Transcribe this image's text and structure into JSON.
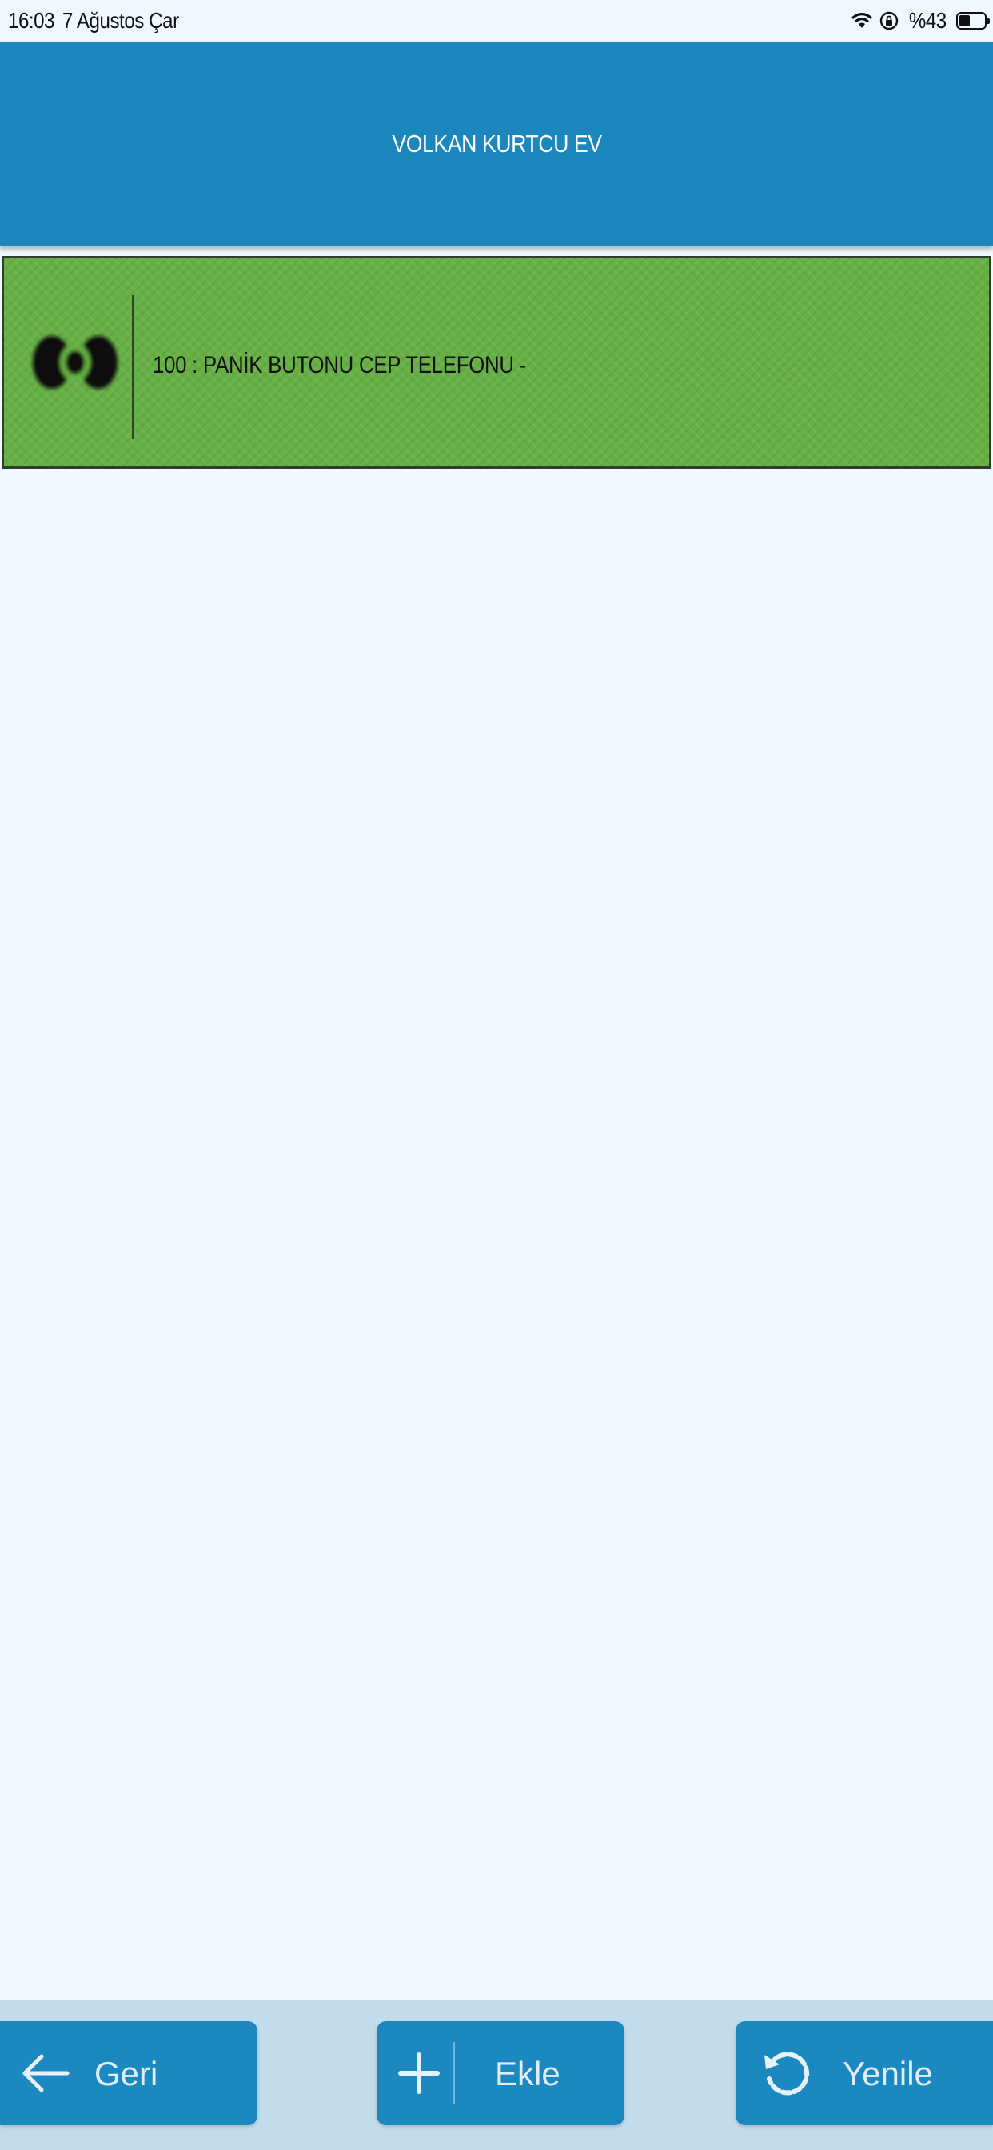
{
  "status_bar": {
    "time": "16:03",
    "date": "7 Ağustos Çar",
    "battery_text": "%43",
    "battery_level": 0.43
  },
  "header": {
    "title": "VOLKAN KURTCU EV"
  },
  "items": [
    {
      "label": "100 : PANİK BUTONU CEP TELEFONU -",
      "icon": "panic-button-icon",
      "color": "#66b044"
    }
  ],
  "toolbar": {
    "back_label": "Geri",
    "add_label": "Ekle",
    "refresh_label": "Yenile"
  },
  "colors": {
    "header": "#1b87bd",
    "button": "#1c88c0",
    "background": "#f1f7fe",
    "bottom_bar": "#c3dcec"
  }
}
